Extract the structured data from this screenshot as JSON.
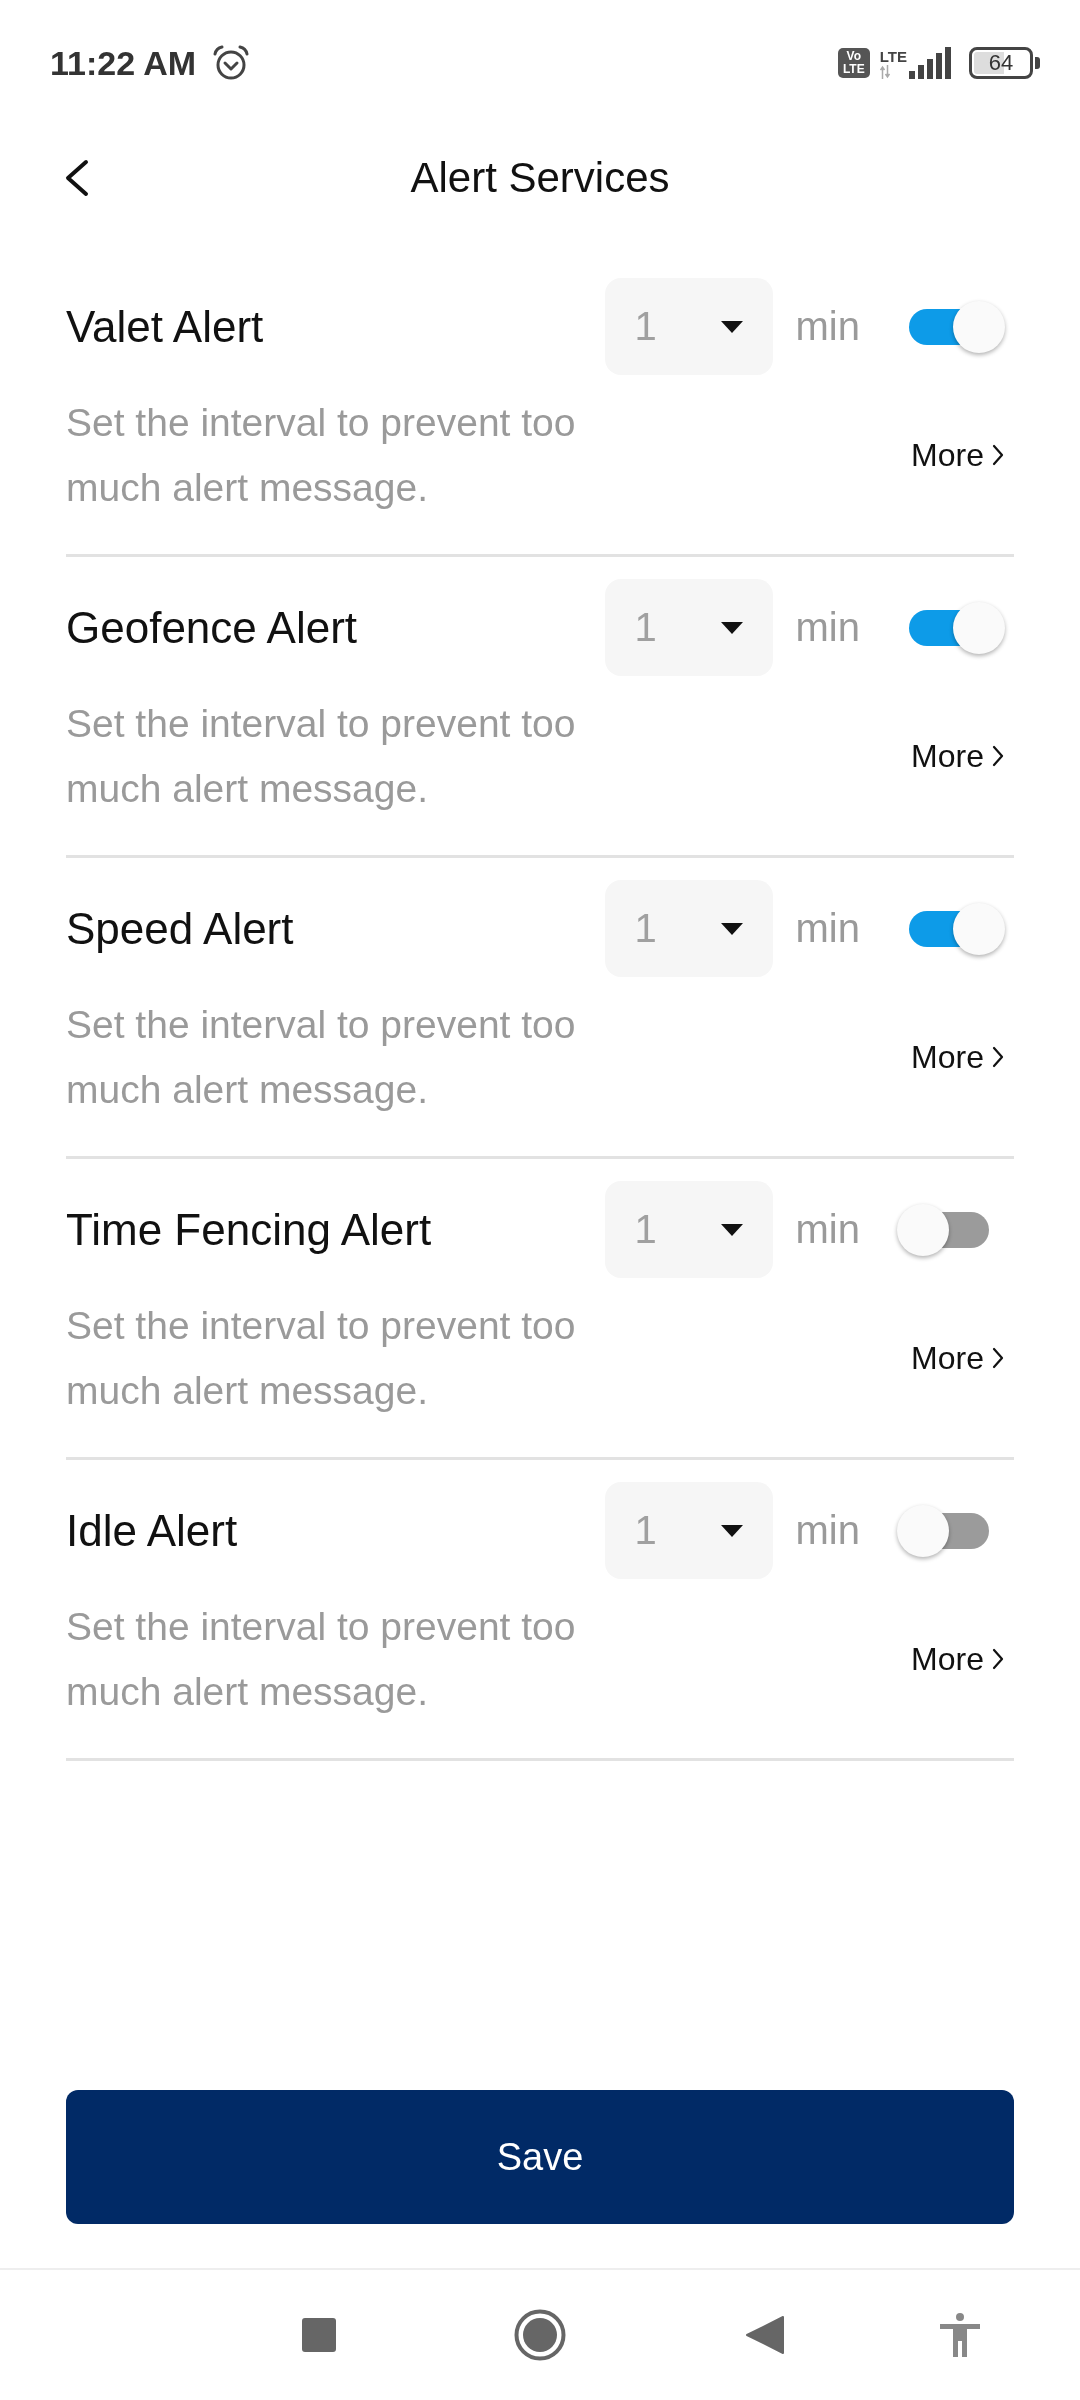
{
  "status_bar": {
    "time": "11:22 AM",
    "volte": [
      "Vo",
      "LTE"
    ],
    "network": "LTE",
    "battery": "64"
  },
  "header": {
    "title": "Alert Services"
  },
  "alerts": [
    {
      "title": "Valet Alert",
      "interval": "1",
      "unit": "min",
      "on": true,
      "description": "Set the interval to prevent too much alert message.",
      "more": "More"
    },
    {
      "title": "Geofence Alert",
      "interval": "1",
      "unit": "min",
      "on": true,
      "description": "Set the interval to prevent too much alert message.",
      "more": "More"
    },
    {
      "title": "Speed Alert",
      "interval": "1",
      "unit": "min",
      "on": true,
      "description": "Set the interval to prevent too much alert message.",
      "more": "More"
    },
    {
      "title": "Time Fencing Alert",
      "interval": "1",
      "unit": "min",
      "on": false,
      "description": "Set the interval to prevent too much alert message.",
      "more": "More"
    },
    {
      "title": "Idle Alert",
      "interval": "1",
      "unit": "min",
      "on": false,
      "description": "Set the interval to prevent too much alert message.",
      "more": "More"
    }
  ],
  "save_button": "Save"
}
